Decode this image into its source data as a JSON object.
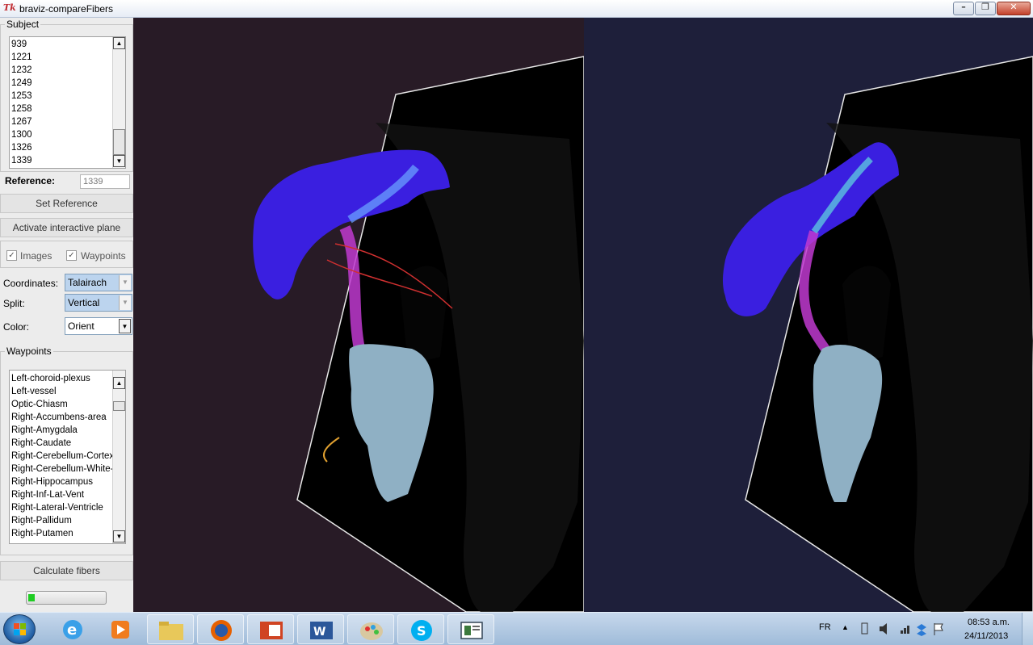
{
  "window": {
    "title": "braviz-compareFibers",
    "icon_text": "Tk",
    "buttons": [
      "minimize",
      "maximize",
      "close"
    ]
  },
  "subject": {
    "group_title": "Subject",
    "items": [
      "939",
      "1221",
      "1232",
      "1249",
      "1253",
      "1258",
      "1267",
      "1300",
      "1326",
      "1339"
    ]
  },
  "reference": {
    "label": "Reference:",
    "value": "1339"
  },
  "buttons": {
    "set_reference": "Set Reference",
    "activate_plane": "Activate interactive plane",
    "calculate_fibers": "Calculate fibers"
  },
  "options": {
    "images_label": "Images",
    "images_checked": true,
    "waypoints_label": "Waypoints",
    "waypoints_checked": true
  },
  "coordinates": {
    "label": "Coordinates:",
    "value": "Talairach"
  },
  "split": {
    "label": "Split:",
    "value": "Vertical"
  },
  "color": {
    "label": "Color:",
    "value": "Orient"
  },
  "waypoints": {
    "group_title": "Waypoints",
    "items": [
      "Left-choroid-plexus",
      "Left-vessel",
      "Optic-Chiasm",
      "Right-Accumbens-area",
      "Right-Amygdala",
      "Right-Caudate",
      "Right-Cerebellum-Cortex",
      "Right-Cerebellum-White-Matter",
      "Right-Hippocampus",
      "Right-Inf-Lat-Vent",
      "Right-Lateral-Ventricle",
      "Right-Pallidum",
      "Right-Putamen"
    ]
  },
  "progress": {
    "fraction": 0.08,
    "color": "#1ecc22"
  },
  "colors": {
    "left_view_bg": "#281b26",
    "right_view_bg": "#1e1f3a",
    "structure_blue": "#3a1fe0",
    "structure_light": "#8fb0c4"
  },
  "taskbar": {
    "pinned": [
      "internet-explorer-icon",
      "media-player-icon",
      "file-explorer-icon",
      "firefox-icon",
      "powerpoint-icon",
      "word-icon",
      "paint-icon",
      "skype-icon",
      "tk-app-icon"
    ],
    "language": "FR",
    "time": "08:53 a.m.",
    "date": "24/11/2013"
  }
}
